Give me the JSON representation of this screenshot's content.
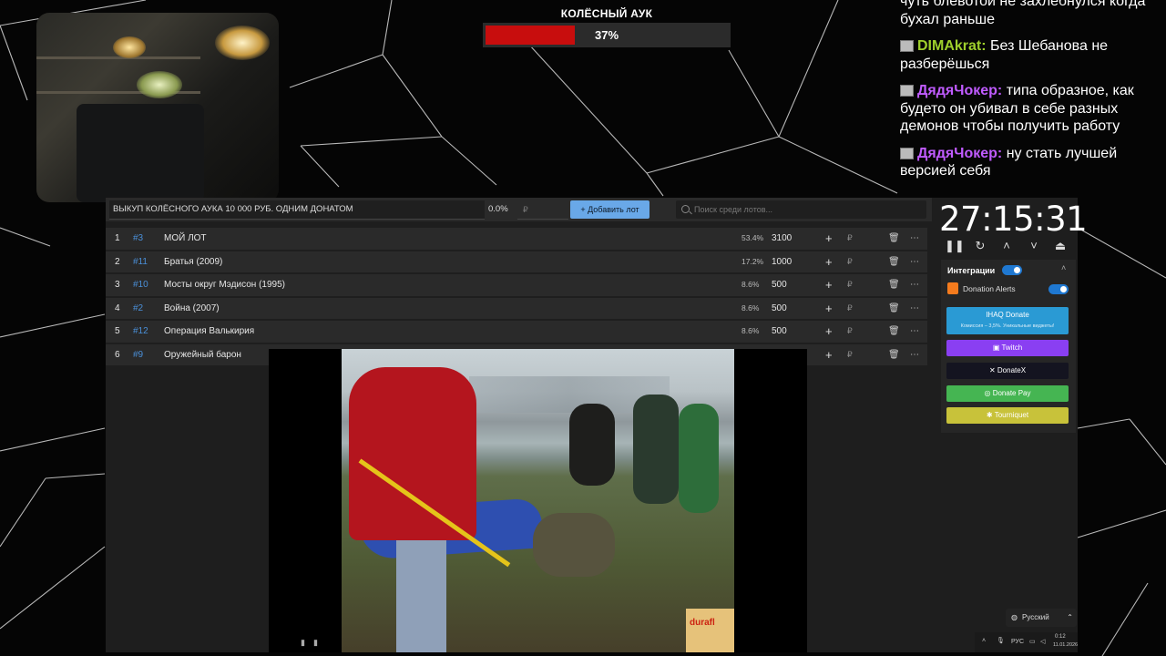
{
  "poll": {
    "title": "КОЛЁСНЫЙ АУК",
    "percent_label": "37%",
    "percent": 37,
    "fill_color": "#c80d0d"
  },
  "chat": [
    {
      "user": "",
      "text": "потому что жена напоминала что он чуть блевотой не захлебнулся когда бухал раньше",
      "visible_text": "чуть блевотой не захлебнулся когда бухал раньше"
    },
    {
      "user": "DIMAkrat:",
      "text": "Без Шебанова не разберёшься"
    },
    {
      "user": "ДядяЧокер:",
      "text": "типа образное, как будето он убивал в себе разных демонов чтобы получить работу"
    },
    {
      "user": "ДядяЧокер:",
      "text": "ну стать лучшей версией себя"
    }
  ],
  "auction": {
    "title_value": "ВЫКУП КОЛЁСНОГО АУКА 10 000 РУБ. ОДНИМ ДОНАТОМ",
    "percent_value": "0.0%",
    "amount_placeholder": "₽",
    "add_button": "Добавить лот",
    "search_placeholder": "Поиск среди лотов...",
    "lots": [
      {
        "n": "1",
        "id": "#3",
        "name": "МОЙ ЛОТ",
        "pct": "53.4%",
        "amount": "3100"
      },
      {
        "n": "2",
        "id": "#11",
        "name": "Братья (2009)",
        "pct": "17.2%",
        "amount": "1000"
      },
      {
        "n": "3",
        "id": "#10",
        "name": "Мосты округ Мэдисон (1995)",
        "pct": "8.6%",
        "amount": "500"
      },
      {
        "n": "4",
        "id": "#2",
        "name": "Война (2007)",
        "pct": "8.6%",
        "amount": "500"
      },
      {
        "n": "5",
        "id": "#12",
        "name": "Операция Валькирия",
        "pct": "8.6%",
        "amount": "500"
      },
      {
        "n": "6",
        "id": "#9",
        "name": "Оружейный барон",
        "pct": "",
        "amount": ""
      }
    ],
    "currency": "₽"
  },
  "video": {
    "box_label": "durafl"
  },
  "sidebar": {
    "timer": "27:15:31",
    "integrations_label": "Интеграции",
    "donation_alerts": "Donation Alerts",
    "buttons": {
      "iq": "IHAQ Donate",
      "iq_sub": "Комиссия – 3,5%. Уникальные виджеты!",
      "twitch": "Twitch",
      "donatex": "DonateX",
      "donatepay": "Donate Pay",
      "tourniquet": "Tourniquet"
    },
    "colors": {
      "iq": "#2a9ad4",
      "twitch": "#8a3ff2",
      "donatex": "#141420",
      "donatepay": "#45b552",
      "tourniquet": "#c8c23a"
    }
  },
  "language": "Русский",
  "tray": {
    "lang": "РУС",
    "time": "0:12",
    "date": "11.01.2026"
  }
}
